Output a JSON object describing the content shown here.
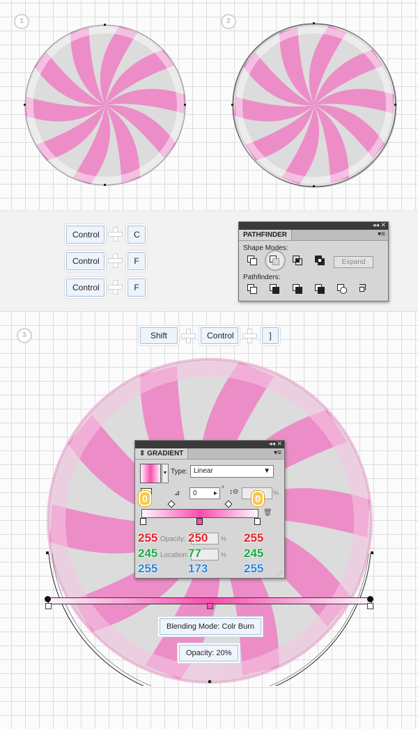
{
  "steps": [
    "1",
    "2",
    "3"
  ],
  "shortcuts": {
    "row1": [
      "Control",
      "C"
    ],
    "row2": [
      "Control",
      "F"
    ],
    "row3": [
      "Control",
      "F"
    ],
    "step3": [
      "Shift",
      "Control",
      "]"
    ]
  },
  "pathfinder": {
    "title": "PATHFINDER",
    "shape_modes_label": "Shape Modes:",
    "pathfinders_label": "Pathfinders:",
    "expand_label": "Expand"
  },
  "gradient": {
    "title": "GRADIENT",
    "type_label": "Type:",
    "type_value": "Linear",
    "angle_value": "0",
    "angle_unit": "°",
    "aspect_unit": "%",
    "opacity_label": "Opacity:",
    "location_label": "Location:",
    "percent": "%"
  },
  "annotations": {
    "left_stop": {
      "r": "255",
      "g": "245",
      "b": "255"
    },
    "mid_stop": {
      "r": "250",
      "g": "77",
      "b": "173"
    },
    "right_stop": {
      "r": "255",
      "g": "245",
      "b": "255"
    },
    "zero_a": "0",
    "zero_b": "0",
    "blending_mode": "Blending Mode: Colr Burn",
    "opacity": "Opacity: 20%"
  },
  "colors": {
    "candy_pink": "#ec8dc8",
    "candy_gray": "#dcdcdc",
    "gradient_mid": "#fa4dad",
    "gradient_end": "#fff5ff"
  }
}
